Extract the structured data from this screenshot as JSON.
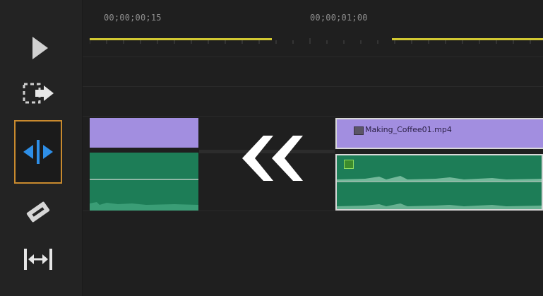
{
  "timeline": {
    "timecodes": [
      "00;00;00;15",
      "00;00;01;00"
    ]
  },
  "clips": {
    "video_clip_name": "Making_Coffee01.mp4"
  },
  "tools": [
    {
      "name": "selection-tool-icon"
    },
    {
      "name": "track-select-forward-tool-icon"
    },
    {
      "name": "ripple-edit-tool-icon",
      "selected": true
    },
    {
      "name": "razor-tool-icon"
    },
    {
      "name": "slip-tool-icon"
    }
  ],
  "colors": {
    "video_clip": "#a28ee0",
    "audio_clip": "#1d7d57",
    "in_out_bar": "#d2c832",
    "selected_tool_outline": "#c98a2e",
    "ripple_arrow": "#2e8fe8"
  }
}
